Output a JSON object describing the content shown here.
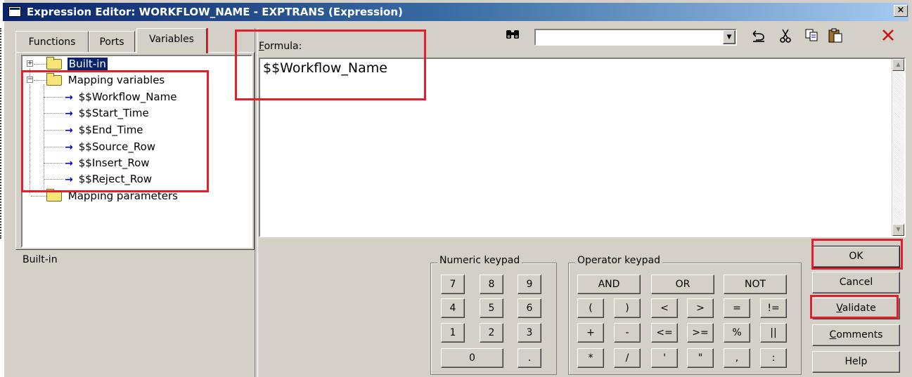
{
  "window": {
    "title": "Expression Editor: WORKFLOW_NAME - EXPTRANS (Expression)",
    "close_glyph": "×"
  },
  "tabs": [
    {
      "label": "Functions"
    },
    {
      "label": "Ports"
    },
    {
      "label": "Variables"
    }
  ],
  "tree": {
    "builtin": "Built-in",
    "mapping_variables": "Mapping variables",
    "variables": [
      "$$Workflow_Name",
      "$$Start_Time",
      "$$End_Time",
      "$$Source_Row",
      "$$Insert_Row",
      "$$Reject_Row"
    ],
    "mapping_parameters": "Mapping parameters",
    "arrow_glyph": "→"
  },
  "description": "Built-in",
  "formula": {
    "label_first": "F",
    "label_rest": "ormula:",
    "value": "$$Workflow_Name"
  },
  "toolbar": {
    "search_value": "",
    "icons": [
      "binoculars-icon",
      "undo-icon",
      "cut-icon",
      "copy-icon",
      "paste-icon",
      "delete-icon"
    ]
  },
  "numeric_keypad": {
    "label": "Numeric keypad",
    "rows": [
      [
        "7",
        "8",
        "9"
      ],
      [
        "4",
        "5",
        "6"
      ],
      [
        "1",
        "2",
        "3"
      ]
    ],
    "zero": "0",
    "dot": "."
  },
  "operator_keypad": {
    "label": "Operator keypad",
    "logic": [
      "AND",
      "OR",
      "NOT"
    ],
    "rows": [
      [
        "(",
        ")",
        "<",
        ">",
        "=",
        "!="
      ],
      [
        "+",
        "-",
        "<=",
        ">=",
        "%",
        "||"
      ],
      [
        "*",
        "/",
        "'",
        "\"",
        ",",
        ":"
      ]
    ]
  },
  "buttons": {
    "ok": "OK",
    "cancel": "Cancel",
    "validate_first": "V",
    "validate_rest": "alidate",
    "comments_first": "C",
    "comments_rest": "omments",
    "help": "Help"
  },
  "colors": {
    "highlight_red": "#e0202a",
    "title_blue": "#0a246a",
    "dialog_gray": "#d4d0c8",
    "arrow_blue": "#0000cc"
  }
}
